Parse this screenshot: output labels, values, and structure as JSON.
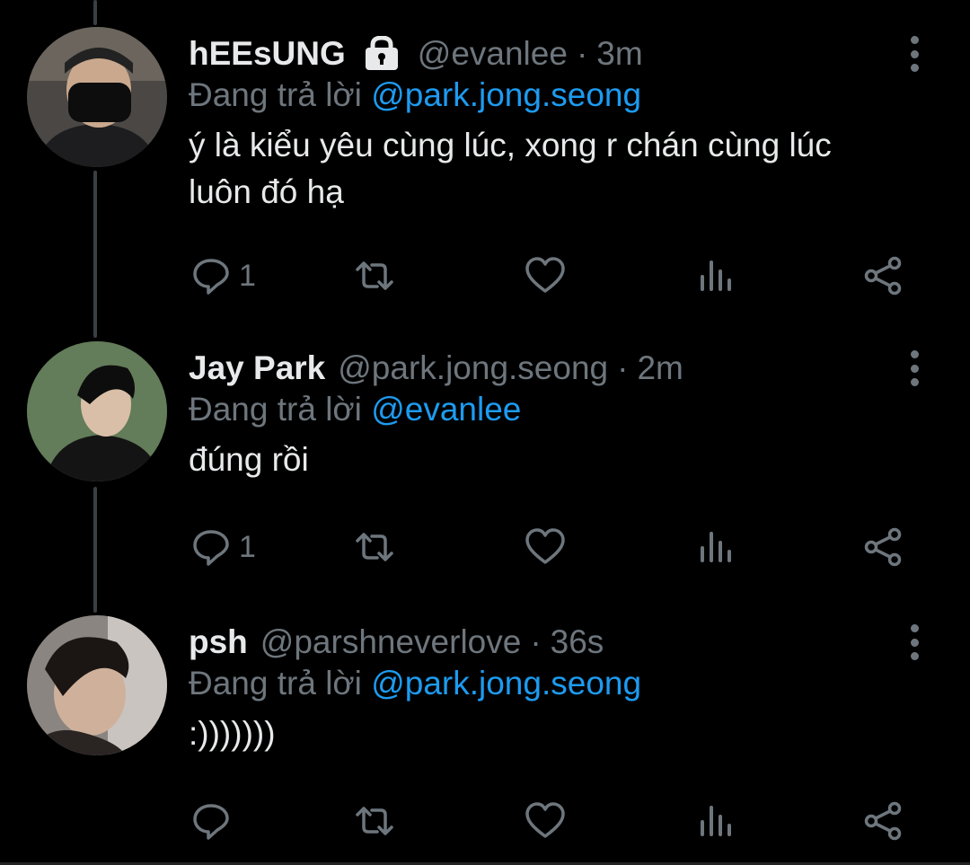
{
  "tweets": [
    {
      "display_name": "hEEsUNG",
      "handle": "@evanlee",
      "separator": "·",
      "time": "3m",
      "reply_prefix": "Đang trả lời",
      "reply_to": "@park.jong.seong",
      "text_line1": "ý là kiểu yêu cùng lúc, xong r chán cùng lúc",
      "text_line2": "luôn đó hạ",
      "reply_count": "1",
      "protected": true
    },
    {
      "display_name": "Jay Park",
      "handle": "@park.jong.seong",
      "separator": "·",
      "time": "2m",
      "reply_prefix": "Đang trả lời",
      "reply_to": "@evanlee",
      "text_line1": "đúng rồi",
      "reply_count": "1"
    },
    {
      "display_name": "psh",
      "handle": "@parshneverlove",
      "separator": "·",
      "time": "36s",
      "reply_prefix": "Đang trả lời",
      "reply_to": "@park.jong.seong",
      "text_line1": ":)))))))",
      "reply_count": ""
    }
  ],
  "icons": [
    "lock-icon",
    "reply-icon",
    "retweet-icon",
    "like-icon",
    "views-icon",
    "share-icon",
    "more-options-icon"
  ],
  "colors": {
    "background": "#000000",
    "text": "#e7e9ea",
    "muted": "#6e767d",
    "mention": "#1d9bf0"
  }
}
